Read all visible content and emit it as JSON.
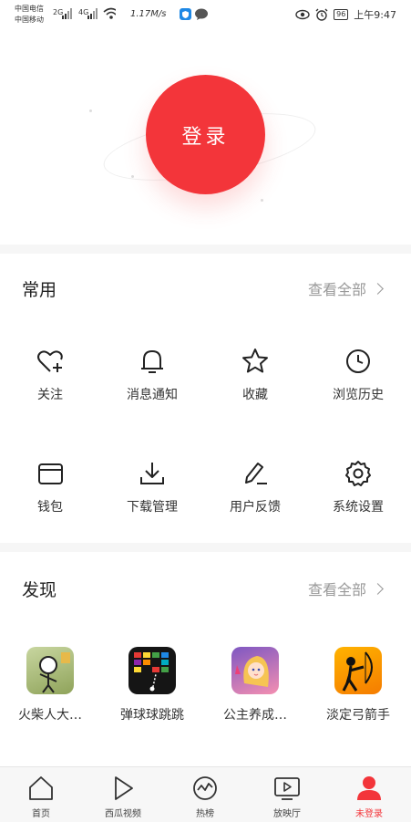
{
  "status_bar": {
    "carrier1": "中国电信",
    "carrier2": "中国移动",
    "net1": "2G",
    "net2": "4G",
    "speed": "1.17M/s",
    "battery": "96",
    "time": "上午9:47"
  },
  "login": {
    "label": "登录"
  },
  "common": {
    "title": "常用",
    "see_all": "查看全部",
    "items": [
      {
        "label": "关注",
        "icon": "heart-plus-icon"
      },
      {
        "label": "消息通知",
        "icon": "bell-icon"
      },
      {
        "label": "收藏",
        "icon": "star-icon"
      },
      {
        "label": "浏览历史",
        "icon": "clock-icon"
      },
      {
        "label": "钱包",
        "icon": "wallet-icon"
      },
      {
        "label": "下载管理",
        "icon": "download-icon"
      },
      {
        "label": "用户反馈",
        "icon": "pen-icon"
      },
      {
        "label": "系统设置",
        "icon": "gear-icon"
      }
    ]
  },
  "discover": {
    "title": "发现",
    "see_all": "查看全部",
    "apps": [
      {
        "label": "火柴人大…"
      },
      {
        "label": "弹球球跳跳"
      },
      {
        "label": "公主养成…"
      },
      {
        "label": "淡定弓箭手"
      }
    ]
  },
  "bottom_nav": {
    "items": [
      {
        "label": "首页",
        "icon": "home-icon"
      },
      {
        "label": "西瓜视频",
        "icon": "play-icon"
      },
      {
        "label": "热榜",
        "icon": "trend-icon"
      },
      {
        "label": "放映厅",
        "icon": "tv-icon"
      },
      {
        "label": "未登录",
        "icon": "user-icon"
      }
    ]
  },
  "colors": {
    "accent": "#f3353a",
    "text": "#222222",
    "muted": "#999999"
  }
}
